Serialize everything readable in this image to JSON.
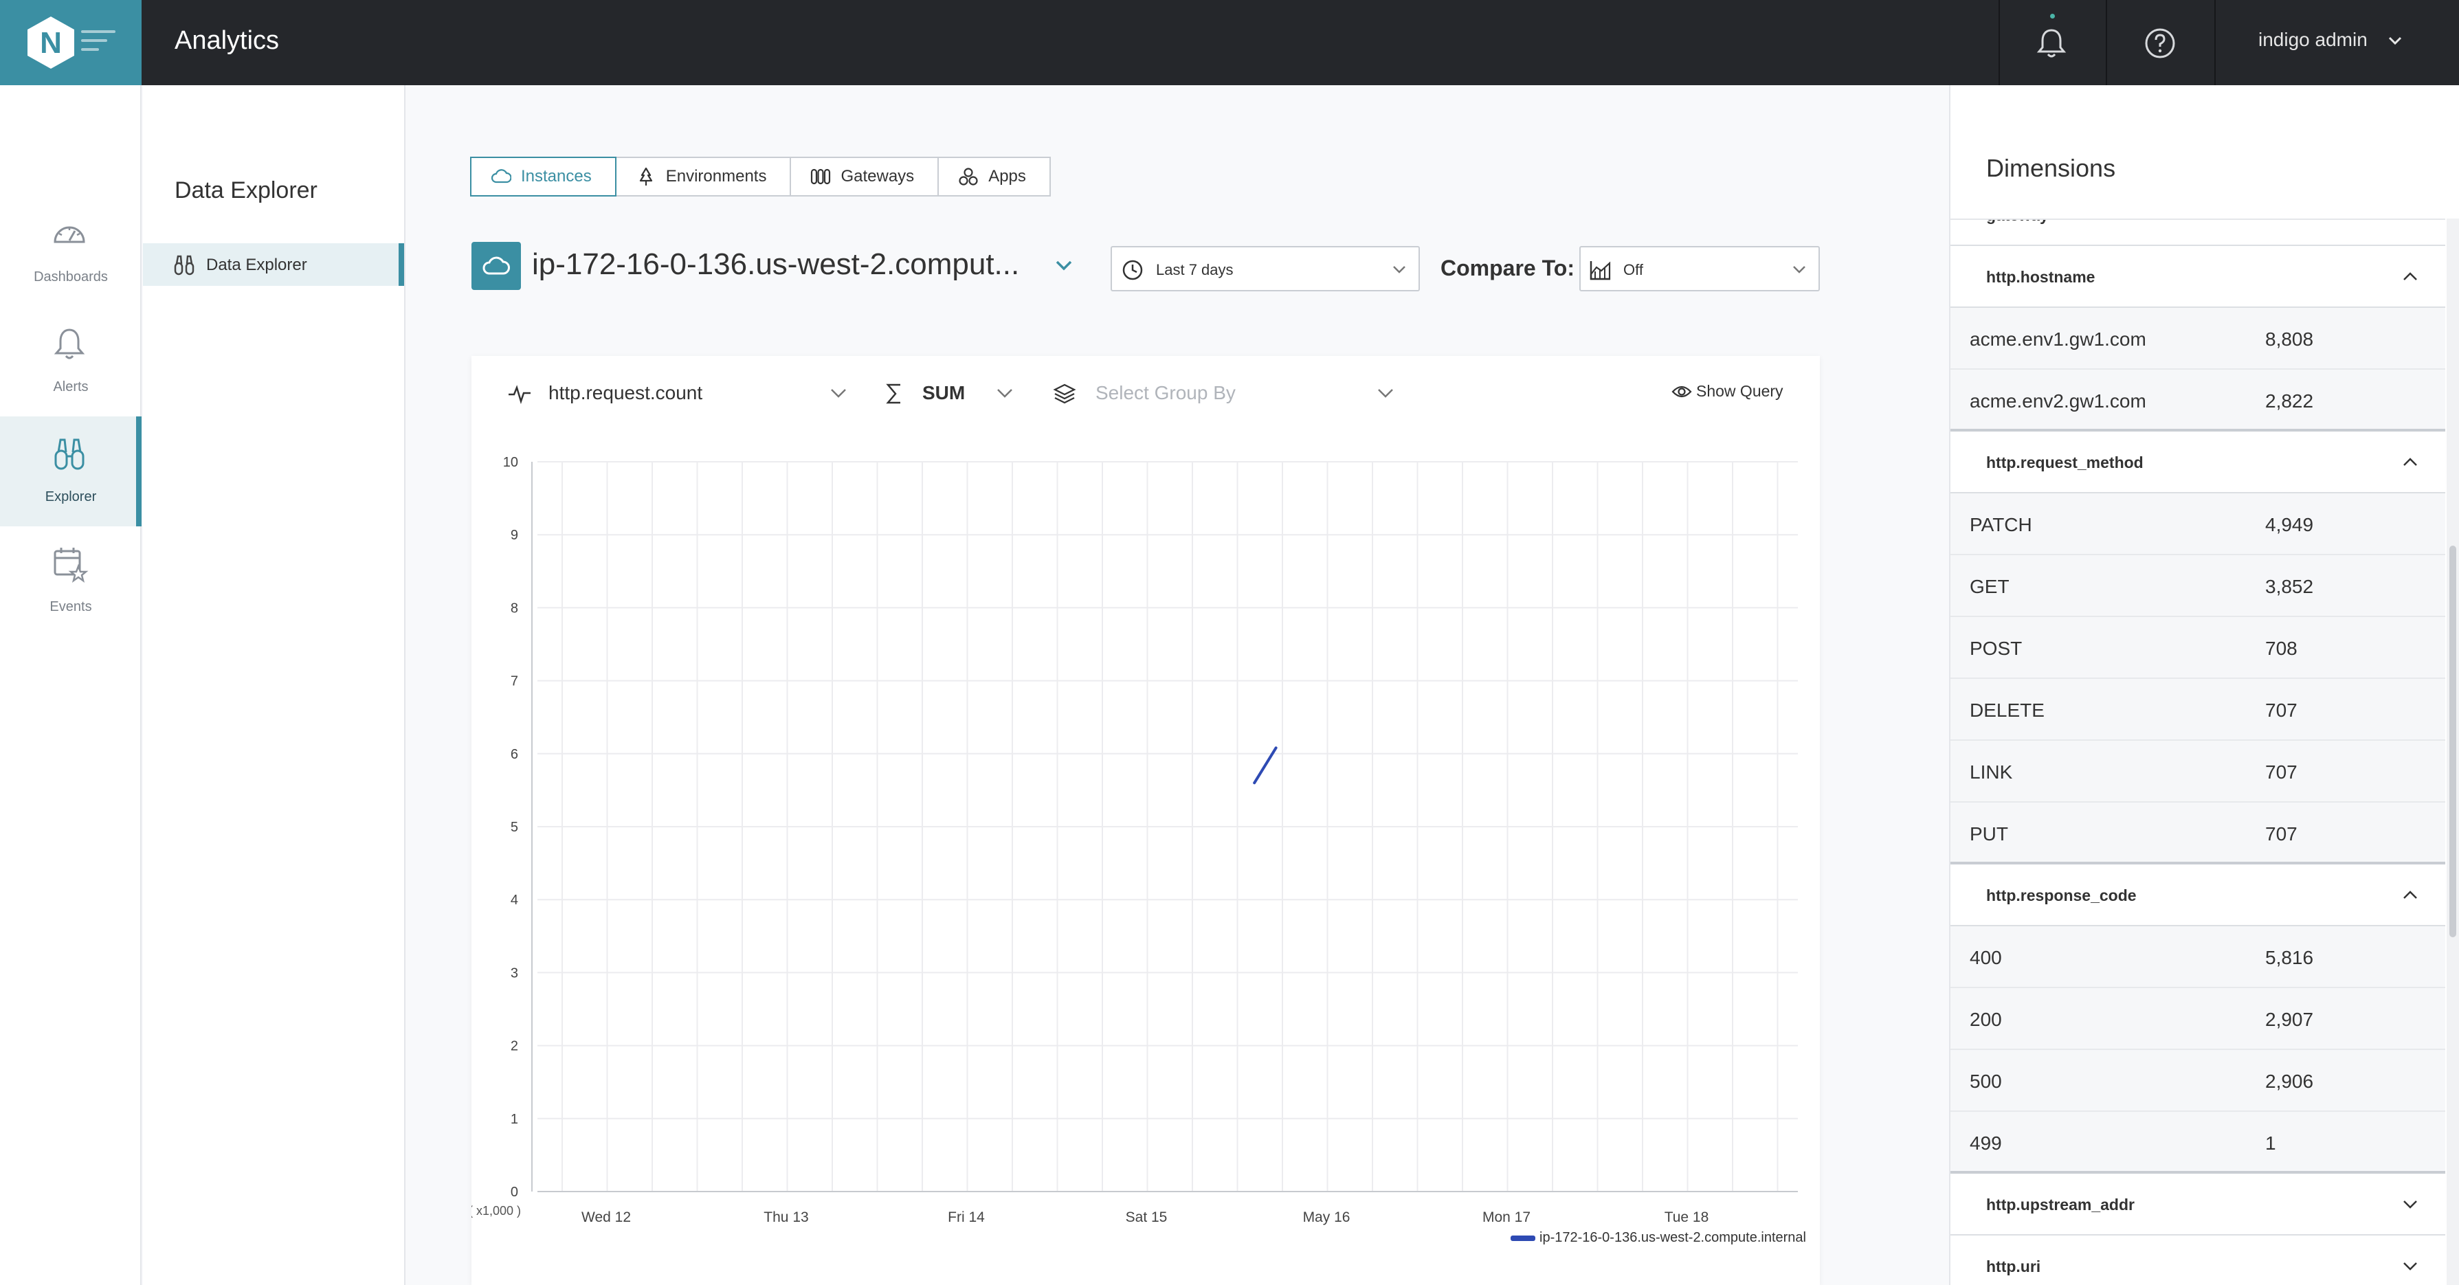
{
  "app": {
    "title": "Analytics",
    "logo_letter": "N"
  },
  "header": {
    "user_name": "indigo admin"
  },
  "nav": {
    "items": [
      {
        "label": "Dashboards",
        "icon": "gauge-icon"
      },
      {
        "label": "Alerts",
        "icon": "bell-icon"
      },
      {
        "label": "Explorer",
        "icon": "binoculars-icon",
        "active": true
      },
      {
        "label": "Events",
        "icon": "calendar-star-icon"
      }
    ]
  },
  "subnav": {
    "title": "Data Explorer",
    "item_label": "Data Explorer"
  },
  "tabs": [
    {
      "label": "Instances",
      "icon": "cloud-icon",
      "active": true
    },
    {
      "label": "Environments",
      "icon": "tree-icon"
    },
    {
      "label": "Gateways",
      "icon": "gateway-icon"
    },
    {
      "label": "Apps",
      "icon": "apps-icon"
    }
  ],
  "instance": {
    "name": "ip-172-16-0-136.us-west-2.comput..."
  },
  "time_range": {
    "value": "Last 7 days"
  },
  "compare": {
    "label": "Compare To:",
    "value": "Off"
  },
  "query": {
    "metric": "http.request.count",
    "aggregation": "SUM",
    "group_by_placeholder": "Select Group By",
    "show_query_label": "Show Query"
  },
  "chart_data": {
    "type": "line",
    "ylim": [
      0,
      10
    ],
    "y_ticks": [
      "0",
      "1",
      "2",
      "3",
      "4",
      "5",
      "6",
      "7",
      "8",
      "9",
      "10"
    ],
    "y_unit_label": "( x1,000 )",
    "x_ticks": [
      "Wed 12",
      "Thu 13",
      "Fri 14",
      "Sat 15",
      "May 16",
      "Mon 17",
      "Tue 18"
    ],
    "grid": true,
    "series": [
      {
        "name": "ip-172-16-0-136.us-west-2.compute.internal",
        "color": "#2e4ab3",
        "points": [
          {
            "x": 3.6,
            "y": 5.6
          },
          {
            "x": 3.72,
            "y": 6.08
          }
        ]
      }
    ]
  },
  "dimensions": {
    "title": "Dimensions",
    "partial_header": "gateway",
    "groups": [
      {
        "name": "http.hostname",
        "expanded": true,
        "rows": [
          {
            "key": "acme.env1.gw1.com",
            "value": "8,808"
          },
          {
            "key": "acme.env2.gw1.com",
            "value": "2,822"
          }
        ]
      },
      {
        "name": "http.request_method",
        "expanded": true,
        "rows": [
          {
            "key": "PATCH",
            "value": "4,949"
          },
          {
            "key": "GET",
            "value": "3,852"
          },
          {
            "key": "POST",
            "value": "708"
          },
          {
            "key": "DELETE",
            "value": "707"
          },
          {
            "key": "LINK",
            "value": "707"
          },
          {
            "key": "PUT",
            "value": "707"
          }
        ]
      },
      {
        "name": "http.response_code",
        "expanded": true,
        "rows": [
          {
            "key": "400",
            "value": "5,816"
          },
          {
            "key": "200",
            "value": "2,907"
          },
          {
            "key": "500",
            "value": "2,906"
          },
          {
            "key": "499",
            "value": "1"
          }
        ]
      },
      {
        "name": "http.upstream_addr",
        "expanded": false,
        "rows": []
      },
      {
        "name": "http.uri",
        "expanded": false,
        "rows": []
      }
    ]
  },
  "colors": {
    "accent": "#3b8fa3",
    "topbar": "#25272b",
    "series": "#2e4ab3"
  }
}
